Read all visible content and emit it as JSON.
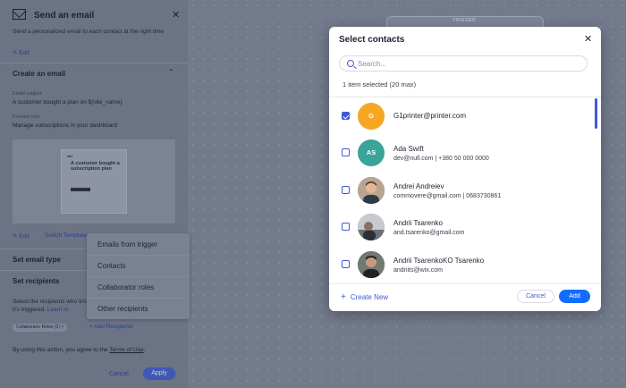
{
  "panel": {
    "title": "Send an email",
    "description": "Send a personalized email to each contact at the right time",
    "edit_label": "Edit",
    "create_email_section": "Create an email",
    "subject_label": "Email subject",
    "subject_value": "A customer bought a plan on ${site_name}",
    "preview_label": "Preview text",
    "preview_value": "Manage subscriptions in your dashboard",
    "preview_brand": "wix",
    "preview_headline": "A customer bought a subscription plan",
    "edit_label_2": "Edit",
    "switch_template": "Switch Template",
    "email_type_section": "Set email type",
    "recipients_section": "Set recipients",
    "recipients_desc": "Select the recipients who time it's triggered.",
    "learn_more": "Learn m",
    "collab_tag": "Collaborator Roles (2)",
    "collab_tag_close": "×",
    "add_recipients": "+ Add Recipients",
    "terms_prefix": "By using this action, you agree to the ",
    "terms_link": "Terms of Use",
    "terms_suffix": ".",
    "cancel": "Cancel",
    "apply": "Apply"
  },
  "canvas": {
    "trigger_label": "TRIGGER"
  },
  "dropdown": {
    "options": [
      "Emails from trigger",
      "Contacts",
      "Collaborator roles",
      "Other recipients"
    ]
  },
  "modal": {
    "title": "Select contacts",
    "search_placeholder": "Search...",
    "selected_count": "1 item selected (20 max)",
    "contacts": [
      {
        "name": "G1printer@printer.com",
        "sub": "",
        "initials": "G",
        "avatar_color": "#f5a623",
        "checked": true
      },
      {
        "name": "Ada Swift",
        "sub": "dev@null.com | +380 50 000 0000",
        "initials": "AS",
        "avatar_color": "#3aa39a",
        "checked": false
      },
      {
        "name": "Andrei Andreiev",
        "sub": "commovere@gmail.com | 0683730861",
        "initials": "",
        "avatar_color": "#8a6a55",
        "checked": false
      },
      {
        "name": "Andrii Tsarenko",
        "sub": "and.tsarenko@gmail.com",
        "initials": "",
        "avatar_color": "#5b5f66",
        "checked": false
      },
      {
        "name": "Andrii TsarenkoKO Tsarenko",
        "sub": "andriits@wix.com",
        "initials": "",
        "avatar_color": "#4e5660",
        "checked": false
      }
    ],
    "create_new": "Create New",
    "cancel": "Cancel",
    "add": "Add"
  }
}
